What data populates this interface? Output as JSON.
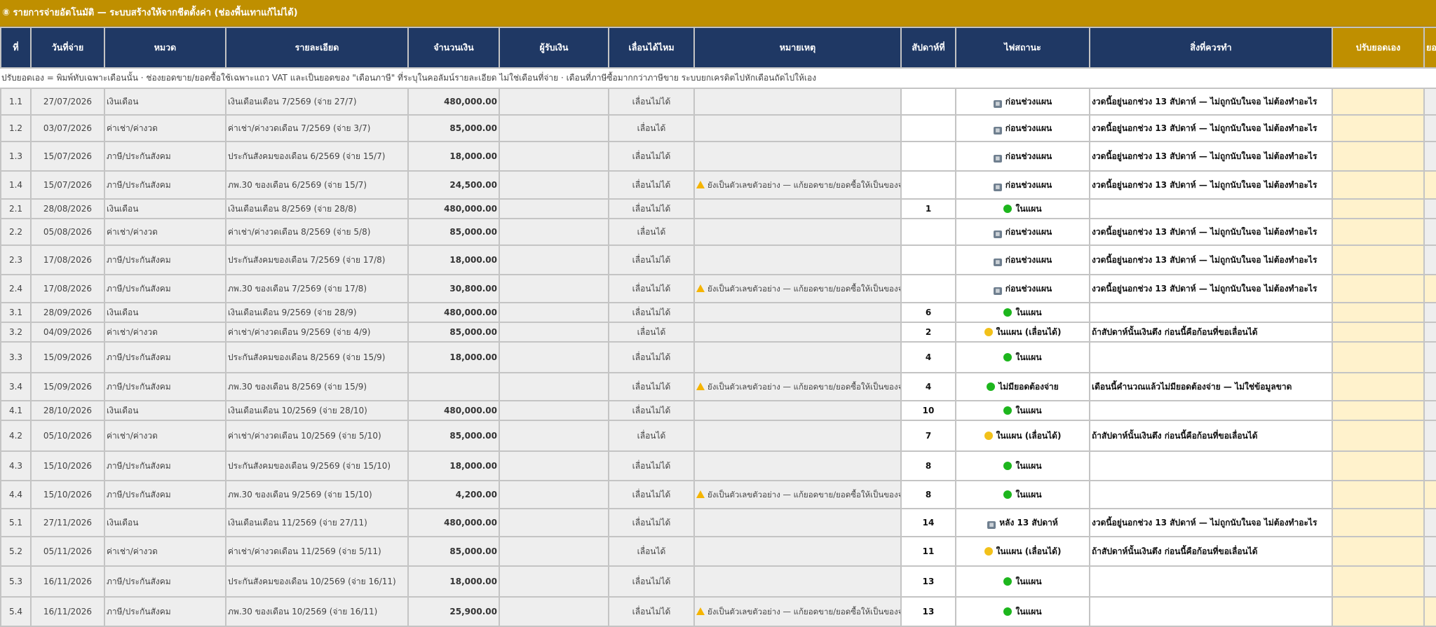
{
  "title": "⑧ รายการจ่ายอัตโนมัติ — ระบบสร้างให้จากชีตตั้งค่า (ช่องพื้นเทาแก้ไม่ได้)",
  "colors": {
    "header_navy": "#1f3864",
    "header_gold": "#bf8f00",
    "locked_gray": "#eeeeee",
    "editable_yellow": "#fff2cc",
    "status_green": "#1db61d",
    "status_yellow": "#f2c11a"
  },
  "columns": [
    "ที่",
    "วันที่จ่าย",
    "หมวด",
    "รายละเอียด",
    "จำนวนเงิน",
    "ผู้รับเงิน",
    "เลื่อนได้ไหม",
    "หมายเหตุ",
    "สัปดาห์ที่",
    "ไฟสถานะ",
    "สิ่งที่ควรทำ",
    "ปรับยอดเอง",
    "ยอด"
  ],
  "note_row": "ปรับยอดเอง = พิมพ์ทับเฉพาะเดือนนั้น · ช่องยอดขาย/ยอดซื้อใช้เฉพาะแถว VAT และเป็นยอดของ \"เดือนภาษี\" ที่ระบุในคอลัมน์รายละเอียด ไม่ใช่เดือนที่จ่าย · เดือนที่ภาษีซื้อมากกว่าภาษีขาย ระบบยกเครดิตไปหักเดือนถัดไปให้เอง",
  "rows": [
    {
      "id": "1.1",
      "date": "27/07/2026",
      "category": "เงินเดือน",
      "detail": "เงินเดือนเดือน 7/2569 (จ่าย 27/7)",
      "amount": "480,000.00",
      "payee": "",
      "defer": "เลื่อนไม่ได้",
      "note": "",
      "week": "",
      "status_icon": "calendar-icon",
      "status": "ก่อนช่วงแผน",
      "action": "งวดนี้อยู่นอกช่วง 13 สัปดาห์ — ไม่ถูกนับในจอ ไม่ต้องทำอะไร"
    },
    {
      "id": "1.2",
      "date": "03/07/2026",
      "category": "ค่าเช่า/ค่างวด",
      "detail": "ค่าเช่า/ค่างวดเดือน 7/2569 (จ่าย 3/7)",
      "amount": "85,000.00",
      "payee": "",
      "defer": "เลื่อนได้",
      "note": "",
      "week": "",
      "status_icon": "calendar-icon",
      "status": "ก่อนช่วงแผน",
      "action": "งวดนี้อยู่นอกช่วง 13 สัปดาห์ — ไม่ถูกนับในจอ ไม่ต้องทำอะไร"
    },
    {
      "id": "1.3",
      "date": "15/07/2026",
      "category": "ภาษี/ประกันสังคม",
      "detail": "ประกันสังคมของเดือน 6/2569 (จ่าย 15/7)",
      "amount": "18,000.00",
      "payee": "",
      "defer": "เลื่อนไม่ได้",
      "note": "",
      "week": "",
      "status_icon": "calendar-icon",
      "status": "ก่อนช่วงแผน",
      "action": "งวดนี้อยู่นอกช่วง 13 สัปดาห์ — ไม่ถูกนับในจอ ไม่ต้องทำอะไร"
    },
    {
      "id": "1.4",
      "date": "15/07/2026",
      "category": "ภาษี/ประกันสังคม",
      "detail": "ภพ.30 ของเดือน 6/2569 (จ่าย 15/7)",
      "amount": "24,500.00",
      "payee": "",
      "defer": "เลื่อนไม่ได้",
      "note": "ยังเป็นตัวเลขตัวอย่าง — แก้ยอดขาย/ยอดซื้อให้เป็นของจริง",
      "week": "",
      "status_icon": "calendar-icon",
      "status": "ก่อนช่วงแผน",
      "action": "งวดนี้อยู่นอกช่วง 13 สัปดาห์ — ไม่ถูกนับในจอ ไม่ต้องทำอะไร"
    },
    {
      "id": "2.1",
      "date": "28/08/2026",
      "category": "เงินเดือน",
      "detail": "เงินเดือนเดือน 8/2569 (จ่าย 28/8)",
      "amount": "480,000.00",
      "payee": "",
      "defer": "เลื่อนไม่ได้",
      "note": "",
      "week": "1",
      "status_icon": "green",
      "status": "ในแผน",
      "action": ""
    },
    {
      "id": "2.2",
      "date": "05/08/2026",
      "category": "ค่าเช่า/ค่างวด",
      "detail": "ค่าเช่า/ค่างวดเดือน 8/2569 (จ่าย 5/8)",
      "amount": "85,000.00",
      "payee": "",
      "defer": "เลื่อนได้",
      "note": "",
      "week": "",
      "status_icon": "calendar-icon",
      "status": "ก่อนช่วงแผน",
      "action": "งวดนี้อยู่นอกช่วง 13 สัปดาห์ — ไม่ถูกนับในจอ ไม่ต้องทำอะไร"
    },
    {
      "id": "2.3",
      "date": "17/08/2026",
      "category": "ภาษี/ประกันสังคม",
      "detail": "ประกันสังคมของเดือน 7/2569 (จ่าย 17/8)",
      "amount": "18,000.00",
      "payee": "",
      "defer": "เลื่อนไม่ได้",
      "note": "",
      "week": "",
      "status_icon": "calendar-icon",
      "status": "ก่อนช่วงแผน",
      "action": "งวดนี้อยู่นอกช่วง 13 สัปดาห์ — ไม่ถูกนับในจอ ไม่ต้องทำอะไร"
    },
    {
      "id": "2.4",
      "date": "17/08/2026",
      "category": "ภาษี/ประกันสังคม",
      "detail": "ภพ.30 ของเดือน 7/2569 (จ่าย 17/8)",
      "amount": "30,800.00",
      "payee": "",
      "defer": "เลื่อนไม่ได้",
      "note": "ยังเป็นตัวเลขตัวอย่าง — แก้ยอดขาย/ยอดซื้อให้เป็นของจริง",
      "week": "",
      "status_icon": "calendar-icon",
      "status": "ก่อนช่วงแผน",
      "action": "งวดนี้อยู่นอกช่วง 13 สัปดาห์ — ไม่ถูกนับในจอ ไม่ต้องทำอะไร"
    },
    {
      "id": "3.1",
      "date": "28/09/2026",
      "category": "เงินเดือน",
      "detail": "เงินเดือนเดือน 9/2569 (จ่าย 28/9)",
      "amount": "480,000.00",
      "payee": "",
      "defer": "เลื่อนไม่ได้",
      "note": "",
      "week": "6",
      "status_icon": "green",
      "status": "ในแผน",
      "action": ""
    },
    {
      "id": "3.2",
      "date": "04/09/2026",
      "category": "ค่าเช่า/ค่างวด",
      "detail": "ค่าเช่า/ค่างวดเดือน 9/2569 (จ่าย 4/9)",
      "amount": "85,000.00",
      "payee": "",
      "defer": "เลื่อนได้",
      "note": "",
      "week": "2",
      "status_icon": "yellow",
      "status": "ในแผน (เลื่อนได้)",
      "action": "ถ้าสัปดาห์นั้นเงินตึง ก่อนนี้คือก้อนที่ขอเลื่อนได้"
    },
    {
      "id": "3.3",
      "date": "15/09/2026",
      "category": "ภาษี/ประกันสังคม",
      "detail": "ประกันสังคมของเดือน 8/2569 (จ่าย 15/9)",
      "amount": "18,000.00",
      "payee": "",
      "defer": "เลื่อนไม่ได้",
      "note": "",
      "week": "4",
      "status_icon": "green",
      "status": "ในแผน",
      "action": ""
    },
    {
      "id": "3.4",
      "date": "15/09/2026",
      "category": "ภาษี/ประกันสังคม",
      "detail": "ภพ.30 ของเดือน 8/2569 (จ่าย 15/9)",
      "amount": "",
      "payee": "",
      "defer": "เลื่อนไม่ได้",
      "note": "ยังเป็นตัวเลขตัวอย่าง — แก้ยอดขาย/ยอดซื้อให้เป็นของจริง",
      "week": "4",
      "status_icon": "green",
      "status": "ไม่มียอดต้องจ่าย",
      "action": "เดือนนี้คำนวณแล้วไม่มียอดต้องจ่าย — ไม่ใช่ข้อมูลขาด"
    },
    {
      "id": "4.1",
      "date": "28/10/2026",
      "category": "เงินเดือน",
      "detail": "เงินเดือนเดือน 10/2569 (จ่าย 28/10)",
      "amount": "480,000.00",
      "payee": "",
      "defer": "เลื่อนไม่ได้",
      "note": "",
      "week": "10",
      "status_icon": "green",
      "status": "ในแผน",
      "action": ""
    },
    {
      "id": "4.2",
      "date": "05/10/2026",
      "category": "ค่าเช่า/ค่างวด",
      "detail": "ค่าเช่า/ค่างวดเดือน 10/2569 (จ่าย 5/10)",
      "amount": "85,000.00",
      "payee": "",
      "defer": "เลื่อนได้",
      "note": "",
      "week": "7",
      "status_icon": "yellow",
      "status": "ในแผน (เลื่อนได้)",
      "action": "ถ้าสัปดาห์นั้นเงินตึง ก่อนนี้คือก้อนที่ขอเลื่อนได้"
    },
    {
      "id": "4.3",
      "date": "15/10/2026",
      "category": "ภาษี/ประกันสังคม",
      "detail": "ประกันสังคมของเดือน 9/2569 (จ่าย 15/10)",
      "amount": "18,000.00",
      "payee": "",
      "defer": "เลื่อนไม่ได้",
      "note": "",
      "week": "8",
      "status_icon": "green",
      "status": "ในแผน",
      "action": ""
    },
    {
      "id": "4.4",
      "date": "15/10/2026",
      "category": "ภาษี/ประกันสังคม",
      "detail": "ภพ.30 ของเดือน 9/2569 (จ่าย 15/10)",
      "amount": "4,200.00",
      "payee": "",
      "defer": "เลื่อนไม่ได้",
      "note": "ยังเป็นตัวเลขตัวอย่าง — แก้ยอดขาย/ยอดซื้อให้เป็นของจริง",
      "week": "8",
      "status_icon": "green",
      "status": "ในแผน",
      "action": ""
    },
    {
      "id": "5.1",
      "date": "27/11/2026",
      "category": "เงินเดือน",
      "detail": "เงินเดือนเดือน 11/2569 (จ่าย 27/11)",
      "amount": "480,000.00",
      "payee": "",
      "defer": "เลื่อนไม่ได้",
      "note": "",
      "week": "14",
      "status_icon": "calendar-icon",
      "status": "หลัง 13 สัปดาห์",
      "action": "งวดนี้อยู่นอกช่วง 13 สัปดาห์ — ไม่ถูกนับในจอ ไม่ต้องทำอะไร"
    },
    {
      "id": "5.2",
      "date": "05/11/2026",
      "category": "ค่าเช่า/ค่างวด",
      "detail": "ค่าเช่า/ค่างวดเดือน 11/2569 (จ่าย 5/11)",
      "amount": "85,000.00",
      "payee": "",
      "defer": "เลื่อนได้",
      "note": "",
      "week": "11",
      "status_icon": "yellow",
      "status": "ในแผน (เลื่อนได้)",
      "action": "ถ้าสัปดาห์นั้นเงินตึง ก่อนนี้คือก้อนที่ขอเลื่อนได้"
    },
    {
      "id": "5.3",
      "date": "16/11/2026",
      "category": "ภาษี/ประกันสังคม",
      "detail": "ประกันสังคมของเดือน 10/2569 (จ่าย 16/11)",
      "amount": "18,000.00",
      "payee": "",
      "defer": "เลื่อนไม่ได้",
      "note": "",
      "week": "13",
      "status_icon": "green",
      "status": "ในแผน",
      "action": ""
    },
    {
      "id": "5.4",
      "date": "16/11/2026",
      "category": "ภาษี/ประกันสังคม",
      "detail": "ภพ.30 ของเดือน 10/2569 (จ่าย 16/11)",
      "amount": "25,900.00",
      "payee": "",
      "defer": "เลื่อนไม่ได้",
      "note": "ยังเป็นตัวเลขตัวอย่าง — แก้ยอดขาย/ยอดซื้อให้เป็นของจริง",
      "week": "13",
      "status_icon": "green",
      "status": "ในแผน",
      "action": ""
    }
  ]
}
